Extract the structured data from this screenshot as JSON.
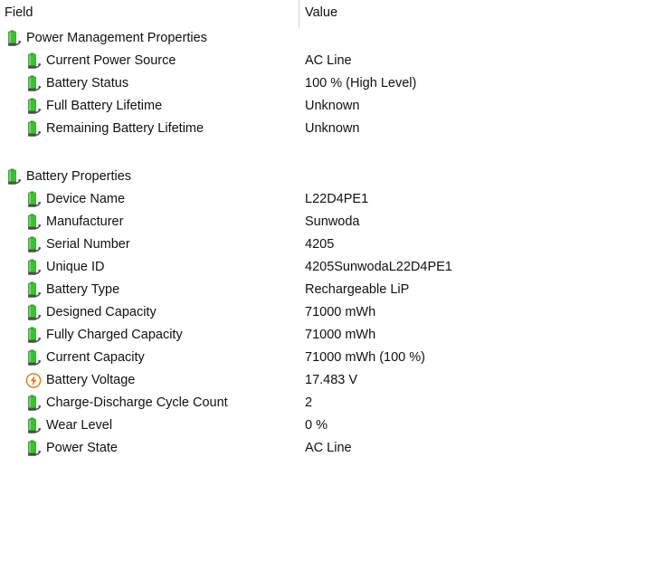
{
  "header": {
    "field_label": "Field",
    "value_label": "Value"
  },
  "colors": {
    "battery_green": "#3DBF36",
    "battery_green_dark": "#2E9E28",
    "battery_highlight": "#9BE08F",
    "plug_gray": "#4D4D4D",
    "bolt_orange": "#E8761B",
    "text": "#111111",
    "divider": "#d6d6d6"
  },
  "rows": [
    {
      "level": 0,
      "icon": "battery-plug-icon",
      "label": "Power Management Properties",
      "value": ""
    },
    {
      "level": 1,
      "icon": "battery-plug-icon",
      "label": "Current Power Source",
      "value": "AC Line"
    },
    {
      "level": 1,
      "icon": "battery-plug-icon",
      "label": "Battery Status",
      "value": "100 % (High Level)"
    },
    {
      "level": 1,
      "icon": "battery-plug-icon",
      "label": "Full Battery Lifetime",
      "value": "Unknown"
    },
    {
      "level": 1,
      "icon": "battery-plug-icon",
      "label": "Remaining Battery Lifetime",
      "value": "Unknown"
    },
    {
      "level": 0,
      "icon": "none",
      "label": "",
      "value": "",
      "spacer": true
    },
    {
      "level": 0,
      "icon": "battery-plug-icon",
      "label": "Battery Properties",
      "value": ""
    },
    {
      "level": 1,
      "icon": "battery-plug-icon",
      "label": "Device Name",
      "value": "L22D4PE1"
    },
    {
      "level": 1,
      "icon": "battery-plug-icon",
      "label": "Manufacturer",
      "value": "Sunwoda"
    },
    {
      "level": 1,
      "icon": "battery-plug-icon",
      "label": "Serial Number",
      "value": "4205"
    },
    {
      "level": 1,
      "icon": "battery-plug-icon",
      "label": "Unique ID",
      "value": "4205SunwodaL22D4PE1"
    },
    {
      "level": 1,
      "icon": "battery-plug-icon",
      "label": "Battery Type",
      "value": "Rechargeable LiP"
    },
    {
      "level": 1,
      "icon": "battery-plug-icon",
      "label": "Designed Capacity",
      "value": "71000 mWh"
    },
    {
      "level": 1,
      "icon": "battery-plug-icon",
      "label": "Fully Charged Capacity",
      "value": "71000 mWh"
    },
    {
      "level": 1,
      "icon": "battery-plug-icon",
      "label": "Current Capacity",
      "value": "71000 mWh  (100 %)"
    },
    {
      "level": 1,
      "icon": "lightning-bolt-icon",
      "label": "Battery Voltage",
      "value": "17.483 V"
    },
    {
      "level": 1,
      "icon": "battery-plug-icon",
      "label": "Charge-Discharge Cycle Count",
      "value": "2"
    },
    {
      "level": 1,
      "icon": "battery-plug-icon",
      "label": "Wear Level",
      "value": "0 %"
    },
    {
      "level": 1,
      "icon": "battery-plug-icon",
      "label": "Power State",
      "value": "AC Line"
    }
  ]
}
